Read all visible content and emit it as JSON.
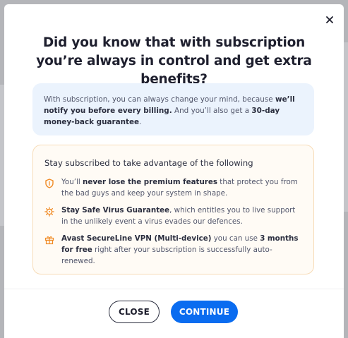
{
  "modal": {
    "title": "Did you know that with subscription you’re always in control and get extra benefits?"
  },
  "info": {
    "part1": "With subscription, you can always change your mind, because ",
    "bold1": "we’ll notify you before every billing.",
    "part2": " And you’ll also get a ",
    "bold2": "30-day money-back guarantee",
    "part3": "."
  },
  "benefits": {
    "title": "Stay subscribed to take advantage of the following",
    "items": [
      {
        "icon": "shield-icon",
        "pre": "You’ll ",
        "bold": "never lose the premium features",
        "post": " that protect you from the bad guys and keep your system in shape.",
        "bold2": "",
        "post2": ""
      },
      {
        "icon": "virus-icon",
        "pre": "",
        "bold": "Stay Safe Virus Guarantee",
        "post": ", which entitles you to live support in the unlikely event a virus evades our defences.",
        "bold2": "",
        "post2": ""
      },
      {
        "icon": "gift-icon",
        "pre": "",
        "bold": "Avast SecureLine VPN (Multi-device)",
        "post": " you can use ",
        "bold2": "3 months for free",
        "post2": " right after your subscription is successfully auto-renewed."
      }
    ]
  },
  "buttons": {
    "close": "CLOSE",
    "continue": "CONTINUE"
  },
  "colors": {
    "accent": "#0a6cf0",
    "icon_orange": "#f08a24",
    "info_bg": "#ebf3fd",
    "benefits_bg": "#fffbf5",
    "benefits_border": "#f7dcb8"
  }
}
